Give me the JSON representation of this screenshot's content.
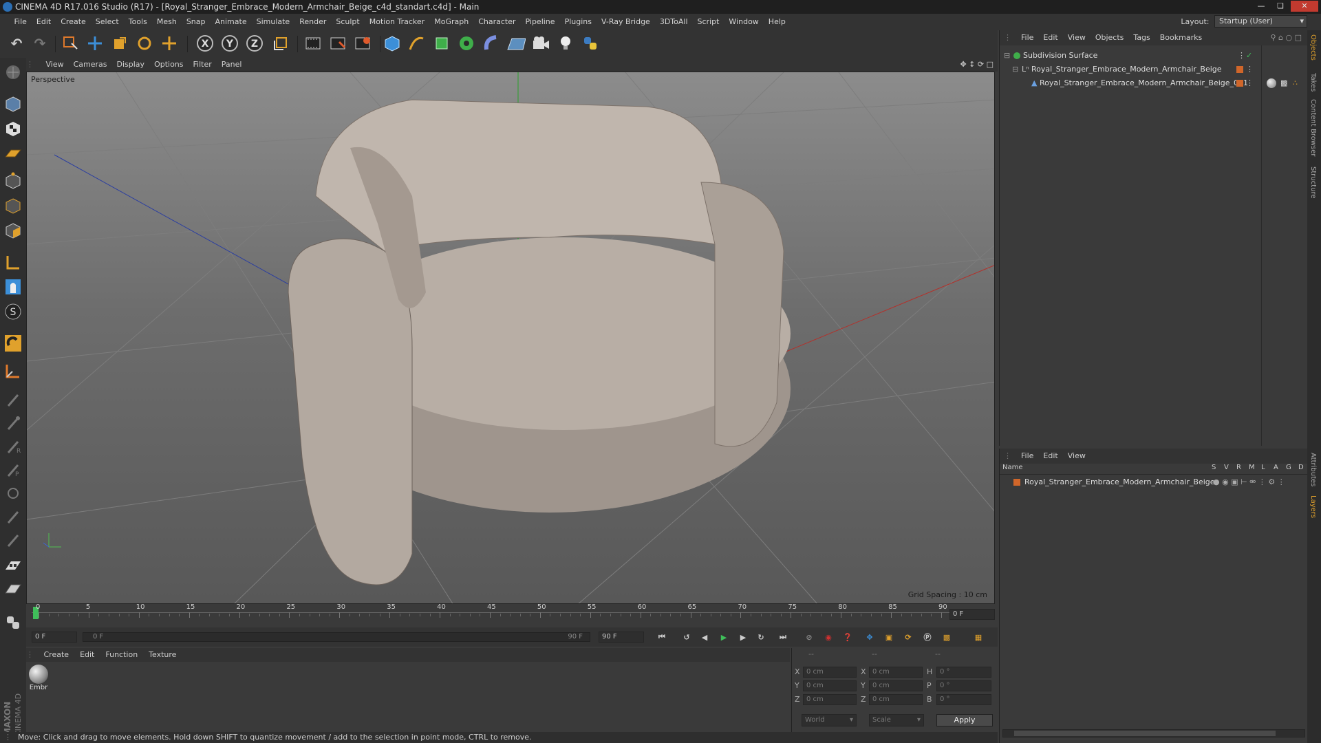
{
  "window": {
    "title": "CINEMA 4D R17.016 Studio (R17) - [Royal_Stranger_Embrace_Modern_Armchair_Beige_c4d_standart.c4d] - Main"
  },
  "menubar": {
    "items": [
      "File",
      "Edit",
      "Create",
      "Select",
      "Tools",
      "Mesh",
      "Snap",
      "Animate",
      "Simulate",
      "Render",
      "Sculpt",
      "Motion Tracker",
      "MoGraph",
      "Character",
      "Pipeline",
      "Plugins",
      "V-Ray Bridge",
      "3DToAll",
      "Script",
      "Window",
      "Help"
    ],
    "layout_label": "Layout:",
    "layout_value": "Startup (User)"
  },
  "viewport": {
    "menu": [
      "View",
      "Cameras",
      "Display",
      "Options",
      "Filter",
      "Panel"
    ],
    "label": "Perspective",
    "grid_spacing": "Grid Spacing : 10 cm"
  },
  "timeline": {
    "ticks": [
      "0",
      "5",
      "10",
      "15",
      "20",
      "25",
      "30",
      "35",
      "40",
      "45",
      "50",
      "55",
      "60",
      "65",
      "70",
      "75",
      "80",
      "85",
      "90"
    ],
    "current_frame": "0 F",
    "start_field": "0 F",
    "range_start": "0 F",
    "range_end": "90 F",
    "end_field": "90 F"
  },
  "material_manager": {
    "menu": [
      "Create",
      "Edit",
      "Function",
      "Texture"
    ],
    "materials": [
      {
        "name": "Embr"
      }
    ]
  },
  "coordinates": {
    "header": [
      "--",
      "--",
      "--"
    ],
    "rows": [
      {
        "a": "X",
        "av": "0 cm",
        "b": "X",
        "bv": "0 cm",
        "c": "H",
        "cv": "0 °"
      },
      {
        "a": "Y",
        "av": "0 cm",
        "b": "Y",
        "bv": "0 cm",
        "c": "P",
        "cv": "0 °"
      },
      {
        "a": "Z",
        "av": "0 cm",
        "b": "Z",
        "bv": "0 cm",
        "c": "B",
        "cv": "0 °"
      }
    ],
    "world": "World",
    "scale": "Scale",
    "apply": "Apply"
  },
  "status": "Move: Click and drag to move elements. Hold down SHIFT to quantize movement / add to the selection in point mode, CTRL to remove.",
  "object_manager": {
    "menu": [
      "File",
      "Edit",
      "View",
      "Objects",
      "Tags",
      "Bookmarks"
    ],
    "objects": [
      {
        "name": "Subdivision Surface"
      },
      {
        "name": "Royal_Stranger_Embrace_Modern_Armchair_Beige"
      },
      {
        "name": "Royal_Stranger_Embrace_Modern_Armchair_Beige_001"
      }
    ]
  },
  "layer_manager": {
    "menu": [
      "File",
      "Edit",
      "View"
    ],
    "columns": [
      "Name",
      "S",
      "V",
      "R",
      "M",
      "L",
      "A",
      "G",
      "D"
    ],
    "layers": [
      {
        "name": "Royal_Stranger_Embrace_Modern_Armchair_Beige",
        "color": "#d0662a"
      }
    ]
  },
  "right_tabs": [
    "Objects",
    "Takes",
    "Content Browser",
    "Structure",
    "Attributes",
    "Layers"
  ],
  "colors": {
    "accent": "#3c8fd8",
    "object_orange": "#d0662a",
    "chair": "#b9ada3"
  },
  "maxon_logo": "MAXON CINEMA 4D"
}
